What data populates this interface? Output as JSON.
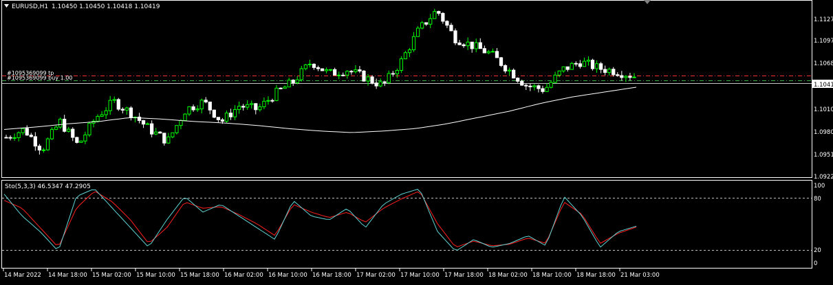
{
  "main_chart": {
    "symbol_label": "EURUSD,H1",
    "ohlc_text": "1.10450 1.10450 1.10418 1.10419",
    "tp_label": "#1095369099 tp",
    "buy_label": "#1095369099 buy 1.00",
    "price_ticks": [
      "1.1127",
      "1.1097",
      "1.1068",
      "1.1010",
      "1.0980",
      "1.0951",
      "1.0922"
    ],
    "current_price": "1.1041",
    "tp_price": 1.1055,
    "entry_price": 1.1046
  },
  "stochastic": {
    "label": "Sto(5,3,3) 46.5347 47.2905",
    "levels": [
      "100",
      "80",
      "20",
      "0"
    ]
  },
  "time_axis": {
    "labels": [
      "14 Mar 2022",
      "14 Mar 18:00",
      "15 Mar 02:00",
      "15 Mar 10:00",
      "15 Mar 18:00",
      "16 Mar 02:00",
      "16 Mar 10:00",
      "16 Mar 18:00",
      "17 Mar 02:00",
      "17 Mar 10:00",
      "17 Mar 18:00",
      "18 Mar 02:00",
      "18 Mar 10:00",
      "18 Mar 18:00",
      "21 Mar 03:00"
    ]
  },
  "colors": {
    "background": "#000000",
    "bull_candle": "#00ff00",
    "bear_candle": "#ffffff",
    "ma_line": "#ffffff",
    "order_line": "#ff3030",
    "stoch_main": "#5fd4d4",
    "stoch_signal": "#ff2020",
    "grid_dash": "#c0c0c0"
  },
  "chart_data": {
    "type": "line",
    "series": [
      {
        "values": [
          1.0965,
          1.0975,
          1.095,
          1.0985,
          1.0955,
          1.099,
          1.101,
          1.0995,
          1.0975,
          1.096,
          1.1,
          1.101,
          1.0985,
          1.1005,
          1.1,
          1.102,
          1.1035,
          1.106,
          1.1045,
          1.105,
          1.104,
          1.103,
          1.106,
          1.11,
          1.1125,
          1.109,
          1.108,
          1.107,
          1.105,
          1.103,
          1.1025,
          1.105,
          1.106,
          1.1052,
          1.1048,
          1.1042
        ]
      },
      {
        "values": [
          1.0975,
          1.0978,
          1.0982,
          1.0985,
          1.099,
          1.0988,
          1.0985,
          1.0983,
          1.098,
          1.0976,
          1.0973,
          1.0971,
          1.0973,
          1.0976,
          1.0982,
          1.099,
          1.0998,
          1.1008,
          1.1016,
          1.1022,
          1.1028
        ]
      },
      {
        "values": [
          88,
          60,
          40,
          15,
          85,
          95,
          70,
          45,
          20,
          55,
          85,
          65,
          75,
          60,
          45,
          30,
          80,
          60,
          55,
          70,
          45,
          75,
          88,
          95,
          40,
          15,
          30,
          20,
          25,
          35,
          22,
          85,
          60,
          20,
          40,
          47
        ]
      },
      {
        "values": [
          80,
          70,
          45,
          20,
          70,
          92,
          78,
          55,
          25,
          45,
          78,
          70,
          72,
          62,
          50,
          35,
          75,
          65,
          58,
          65,
          52,
          70,
          82,
          92,
          50,
          20,
          28,
          22,
          24,
          32,
          25,
          78,
          62,
          25,
          38,
          46
        ]
      }
    ]
  }
}
